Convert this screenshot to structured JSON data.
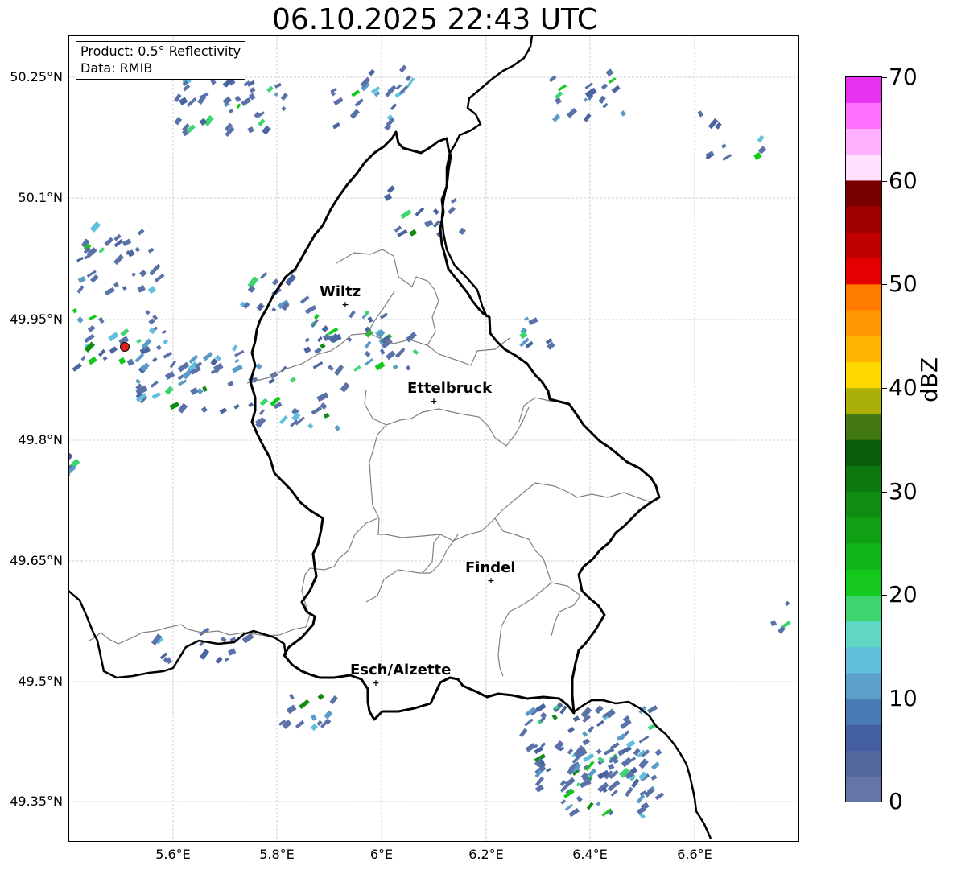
{
  "title": "06.10.2025 22:43 UTC",
  "info": {
    "product": "Product: 0.5° Reflectivity",
    "data": "Data: RMIB"
  },
  "axes": {
    "x_ticks": [
      "5.6°E",
      "5.8°E",
      "6°E",
      "6.2°E",
      "6.4°E",
      "6.6°E"
    ],
    "y_ticks": [
      "50.25°N",
      "50.1°N",
      "49.95°N",
      "49.8°N",
      "49.65°N",
      "49.5°N",
      "49.35°N"
    ]
  },
  "cities": [
    {
      "name": "Wiltz"
    },
    {
      "name": "Ettelbruck"
    },
    {
      "name": "Findel"
    },
    {
      "name": "Esch/Alzette"
    }
  ],
  "colorbar": {
    "label": "dBZ",
    "ticks": [
      "70",
      "60",
      "50",
      "40",
      "30",
      "20",
      "10",
      "0"
    ],
    "colors_bottom_to_top": [
      "#6475a8",
      "#5468a0",
      "#4460a0",
      "#4a7ab4",
      "#5aa0c8",
      "#62c0dc",
      "#60d6c4",
      "#3ed470",
      "#14c81c",
      "#10b418",
      "#10a014",
      "#108c10",
      "#0c7810",
      "#0a5e0a",
      "#447810",
      "#aab008",
      "#ffd800",
      "#ffb400",
      "#ff9800",
      "#ff7c00",
      "#e40000",
      "#c00000",
      "#a00000",
      "#7a0000",
      "#ffe0ff",
      "#ffb0ff",
      "#ff70ff",
      "#e830f0"
    ]
  },
  "colors": {
    "border": "#000000",
    "cantons": "#808080",
    "grid": "#c0c0c0",
    "radar_site": "#e02020"
  }
}
